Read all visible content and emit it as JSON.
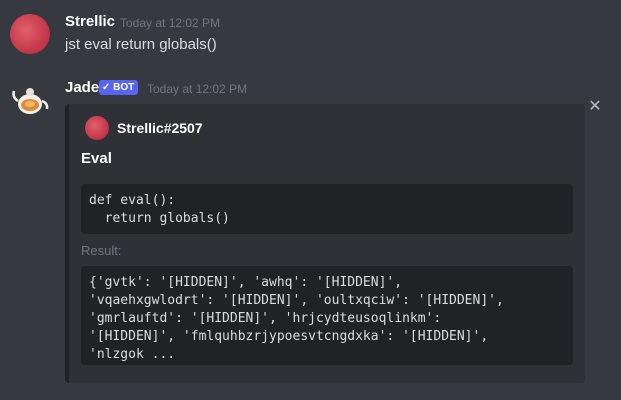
{
  "messages": [
    {
      "username": "Strellic",
      "timestamp": "Today at 12:02 PM",
      "content": "jst eval return globals()"
    },
    {
      "username": "Jade",
      "bot_tag": "✓ BOT",
      "timestamp": "Today at 12:02 PM",
      "embed": {
        "author": "Strellic#2507",
        "title": "Eval",
        "code": "def eval():\n  return globals()",
        "result_label": "Result:",
        "result": "{'gvtk': '[HIDDEN]', 'awhq': '[HIDDEN]',\n'vqaehxgwlodrt': '[HIDDEN]', 'oultxqciw': '[HIDDEN]',\n'gmrlauftd': '[HIDDEN]', 'hrjcydteusoqlinkm':\n'[HIDDEN]', 'fmlquhbzrjypoesvtcngdxka': '[HIDDEN]',\n'nlzgok ..."
      }
    }
  ],
  "icons": {
    "close": "close-icon"
  },
  "colors": {
    "background": "#36393f",
    "embed_background": "#2f3136",
    "code_background": "#202225",
    "bot_tag": "#5865f2",
    "timestamp": "#72767d"
  }
}
